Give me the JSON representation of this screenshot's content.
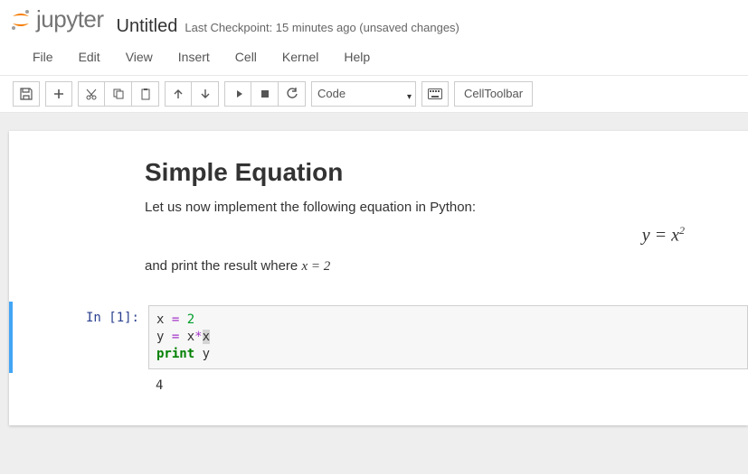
{
  "header": {
    "logo_text": "jupyter",
    "title": "Untitled",
    "checkpoint": "Last Checkpoint: 15 minutes ago (unsaved changes)"
  },
  "menubar": [
    "File",
    "Edit",
    "View",
    "Insert",
    "Cell",
    "Kernel",
    "Help"
  ],
  "toolbar": {
    "cell_type": "Code",
    "celltoolbar_label": "CellToolbar"
  },
  "markdown": {
    "heading": "Simple Equation",
    "p1": "Let us now implement the following equation in Python:",
    "equation": "y = x",
    "equation_sup": "2",
    "p2_pre": "and print the result where ",
    "p2_math": "x = 2"
  },
  "code": {
    "prompt": "In [1]:",
    "lines": {
      "l1_a": "x ",
      "l1_op": "=",
      "l1_b": " ",
      "l1_num": "2",
      "l2_a": "y ",
      "l2_op": "=",
      "l2_b": " x",
      "l2_star": "*",
      "l2_c": "x",
      "l3_kw": "print",
      "l3_b": " y"
    },
    "output": "4"
  }
}
